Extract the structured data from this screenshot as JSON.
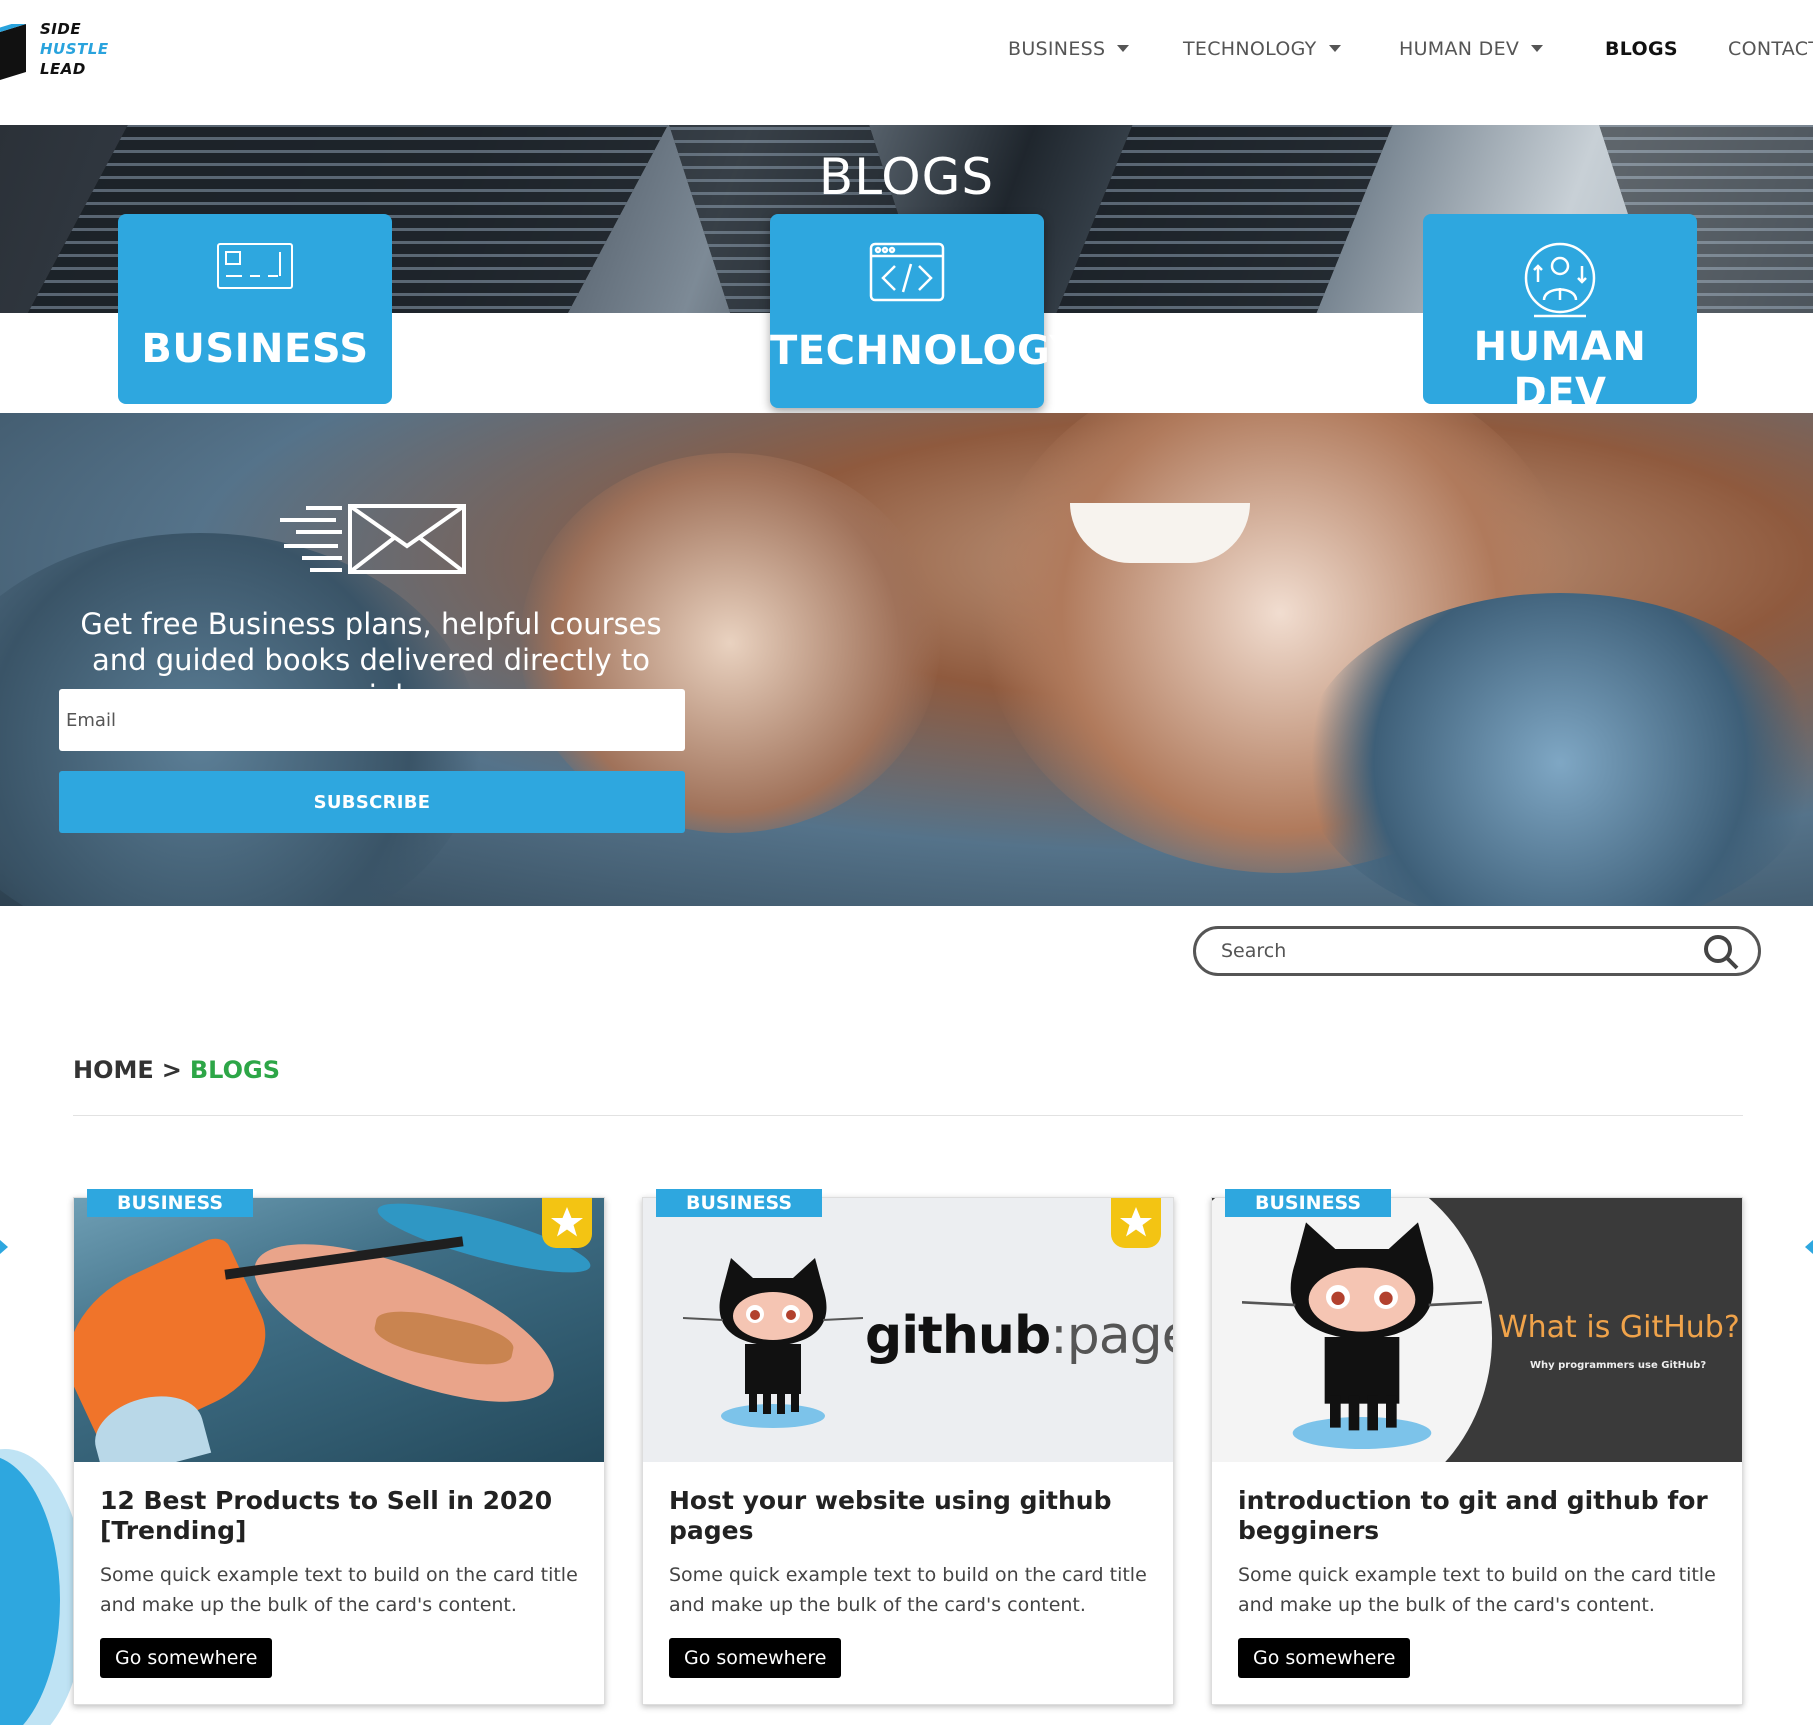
{
  "brand": {
    "line1": "SIDE",
    "line2": "HUSTLE",
    "line3": "LEAD"
  },
  "nav": {
    "items": [
      {
        "label": "BUSINESS",
        "dropdown": true
      },
      {
        "label": "TECHNOLOGY",
        "dropdown": true
      },
      {
        "label": "HUMAN DEV",
        "dropdown": true
      },
      {
        "label": "BLOGS",
        "dropdown": false,
        "active": true
      },
      {
        "label": "CONTACT",
        "dropdown": false
      }
    ]
  },
  "hero": {
    "title": "BLOGS"
  },
  "categories": [
    {
      "label": "BUSINESS",
      "icon": "card-icon"
    },
    {
      "label": "TECHNOLOGY",
      "icon": "code-window-icon"
    },
    {
      "label": "HUMAN DEV",
      "icon": "person-globe-icon"
    }
  ],
  "subscribe": {
    "text": "Get free Business plans, helpful courses and guided books delivered directly to your inbox",
    "email_placeholder": "Email",
    "button": "SUBSCRIBE"
  },
  "search": {
    "placeholder": "Search"
  },
  "breadcrumb": {
    "home": "HOME",
    "separator": ">",
    "current": "BLOGS"
  },
  "posts": [
    {
      "tag": "BUSINESS",
      "featured": true,
      "title": "12 Best Products to Sell in 2020 [Trending]",
      "desc": "Some quick example text to build on the card title and make up the bulk of the card's content.",
      "button": "Go somewhere"
    },
    {
      "tag": "BUSINESS",
      "featured": true,
      "title": "Host your website using github pages",
      "desc": "Some quick example text to build on the card title and make up the bulk of the card's content.",
      "button": "Go somewhere",
      "image_text": {
        "github": "github",
        "pages": ":pages"
      }
    },
    {
      "tag": "BUSINESS",
      "featured": false,
      "title": "introduction to git and github for begginers",
      "desc": "Some quick example text to build on the card title and make up the bulk of the card's content.",
      "button": "Go somewhere",
      "image_text": {
        "headline": "What is GitHub?",
        "sub": "Why programmers use GitHub?"
      }
    }
  ],
  "colors": {
    "accent": "#2ea7df",
    "breadcrumb_current": "#2da647",
    "star": "#f3c413"
  }
}
